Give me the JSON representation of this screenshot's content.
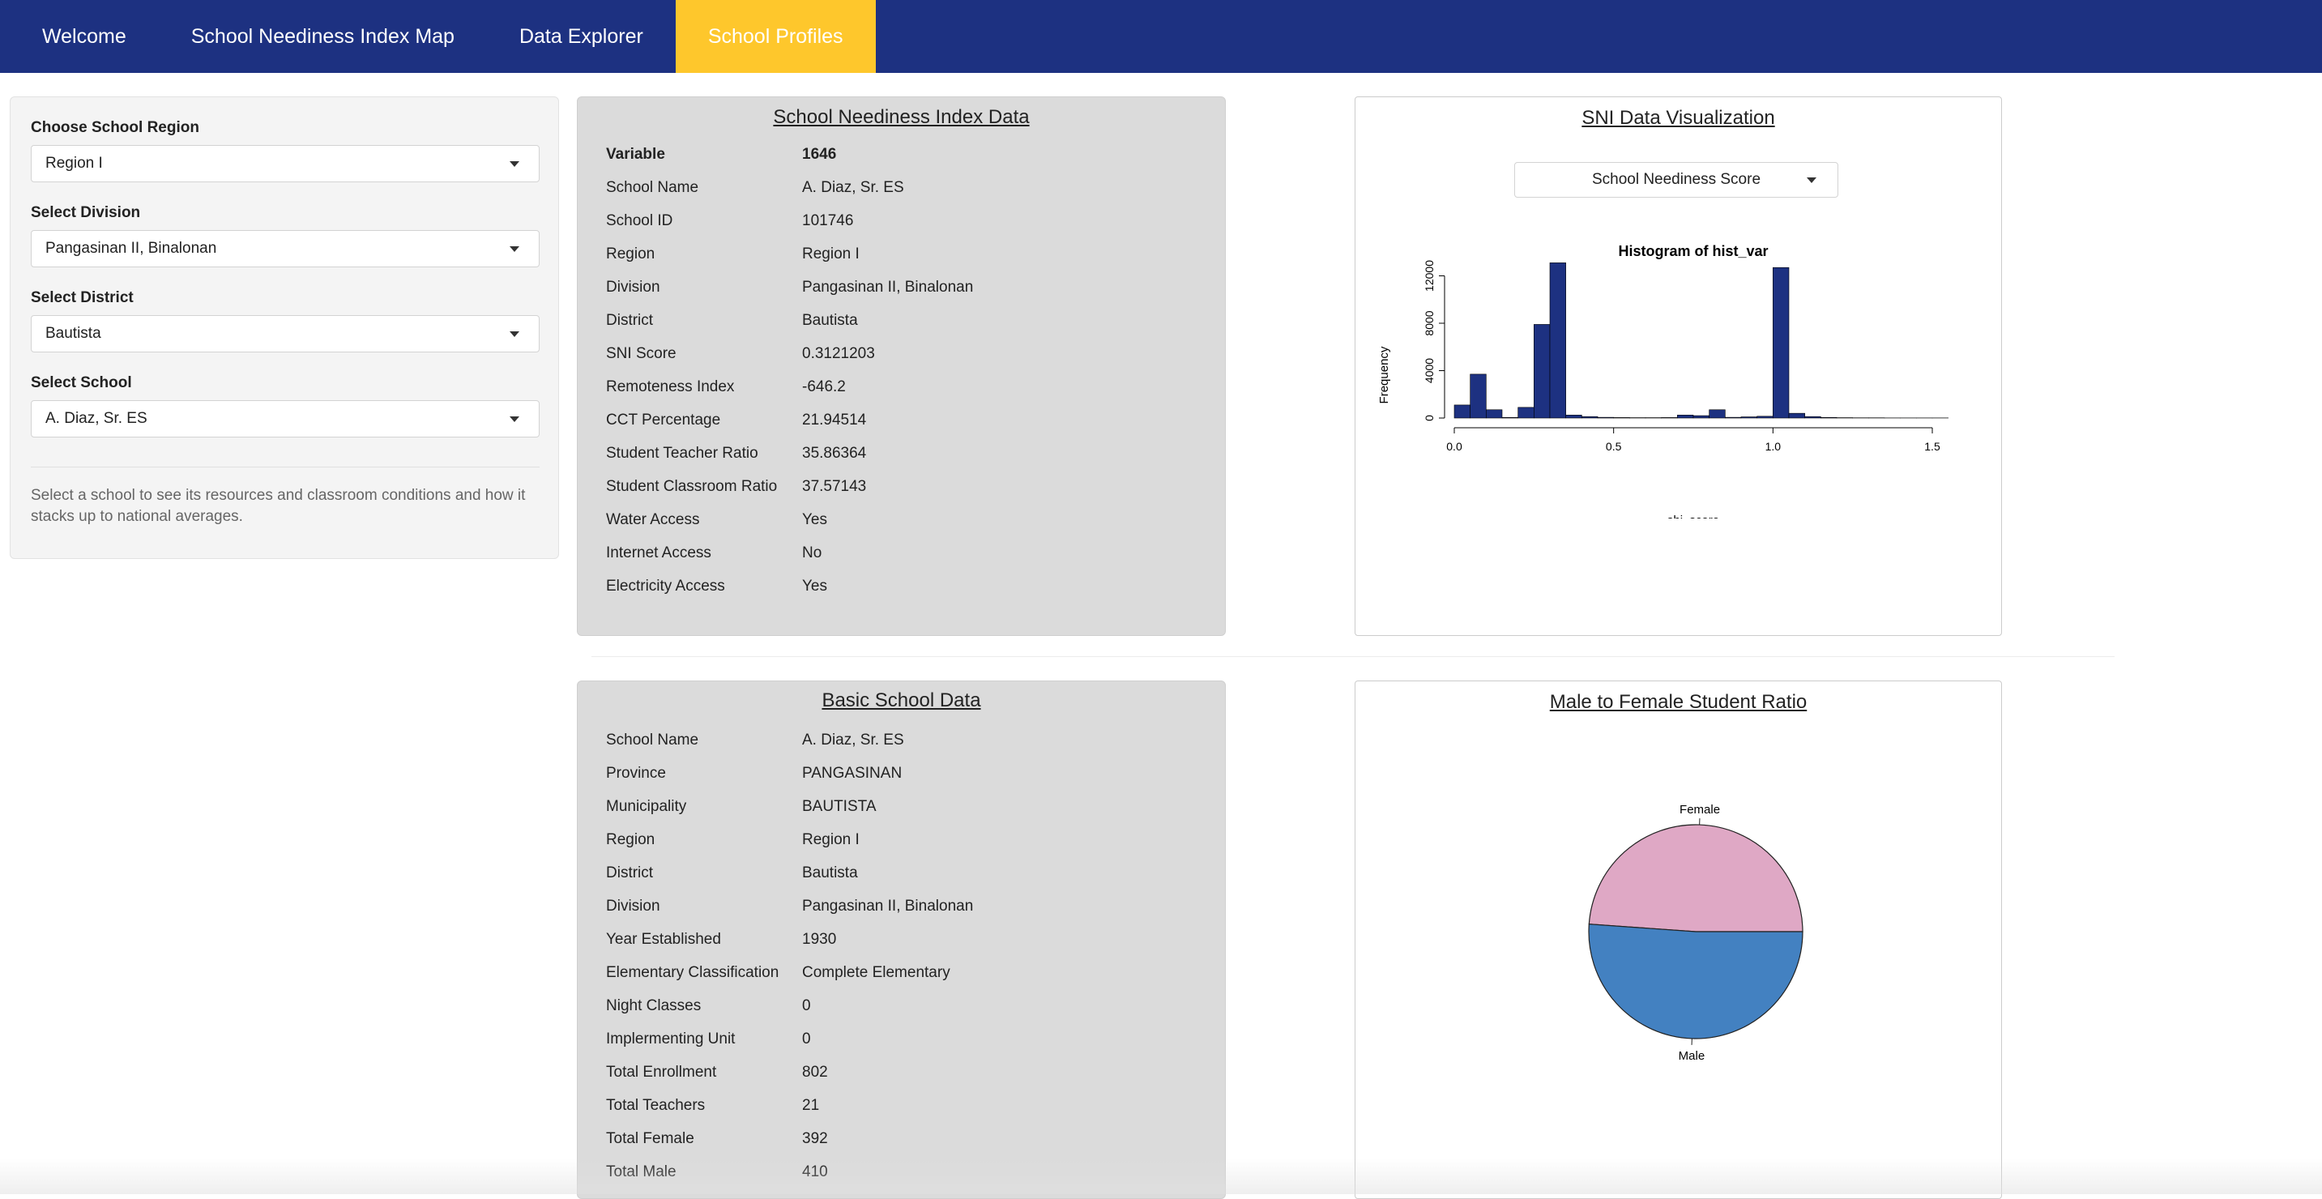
{
  "nav": {
    "items": [
      {
        "label": "Welcome",
        "active": false
      },
      {
        "label": "School Neediness Index Map",
        "active": false
      },
      {
        "label": "Data Explorer",
        "active": false
      },
      {
        "label": "School Profiles",
        "active": true
      }
    ]
  },
  "sidebar": {
    "region": {
      "label": "Choose School Region",
      "value": "Region I"
    },
    "division": {
      "label": "Select Division",
      "value": "Pangasinan II, Binalonan"
    },
    "district": {
      "label": "Select District",
      "value": "Bautista"
    },
    "school": {
      "label": "Select School",
      "value": "A. Diaz, Sr. ES"
    },
    "help_text": "Select a school to see its resources and classroom conditions and how it stacks up to national averages."
  },
  "sni_panel": {
    "title": "School Neediness Index Data",
    "header": {
      "key": "Variable",
      "value": "1646"
    },
    "rows": [
      {
        "key": "School Name",
        "value": "A. Diaz, Sr. ES"
      },
      {
        "key": "School ID",
        "value": "101746"
      },
      {
        "key": "Region",
        "value": "Region I"
      },
      {
        "key": "Division",
        "value": "Pangasinan II, Binalonan"
      },
      {
        "key": "District",
        "value": "Bautista"
      },
      {
        "key": "SNI Score",
        "value": "0.3121203"
      },
      {
        "key": "Remoteness Index",
        "value": "-646.2"
      },
      {
        "key": "CCT Percentage",
        "value": "21.94514"
      },
      {
        "key": "Student Teacher Ratio",
        "value": "35.86364"
      },
      {
        "key": "Student Classroom Ratio",
        "value": "37.57143"
      },
      {
        "key": "Water Access",
        "value": "Yes"
      },
      {
        "key": "Internet Access",
        "value": "No"
      },
      {
        "key": "Electricity Access",
        "value": "Yes"
      }
    ]
  },
  "basic_panel": {
    "title": "Basic School Data",
    "rows": [
      {
        "key": "School Name",
        "value": "A. Diaz, Sr. ES"
      },
      {
        "key": "Province",
        "value": "PANGASINAN"
      },
      {
        "key": "Municipality",
        "value": "BAUTISTA"
      },
      {
        "key": "Region",
        "value": "Region I"
      },
      {
        "key": "District",
        "value": "Bautista"
      },
      {
        "key": "Division",
        "value": "Pangasinan II, Binalonan"
      },
      {
        "key": "Year Established",
        "value": "1930"
      },
      {
        "key": "Elementary Classification",
        "value": "Complete Elementary"
      },
      {
        "key": "Night Classes",
        "value": "0"
      },
      {
        "key": "Implermenting Unit",
        "value": "0"
      },
      {
        "key": "Total Enrollment",
        "value": "802"
      },
      {
        "key": "Total Teachers",
        "value": "21"
      },
      {
        "key": "Total Female",
        "value": "392"
      },
      {
        "key": "Total Male",
        "value": "410"
      }
    ]
  },
  "sni_viz": {
    "title": "SNI Data Visualization",
    "select_value": "School Neediness Score"
  },
  "ratio_viz": {
    "title": "Male to Female Student Ratio"
  },
  "chart_data": [
    {
      "type": "bar",
      "title": "Histogram of hist_var",
      "xlabel": "shi_score",
      "ylabel": "Frequency",
      "bin_width": 0.05,
      "x": [
        0.0,
        0.05,
        0.1,
        0.15,
        0.2,
        0.25,
        0.3,
        0.35,
        0.4,
        0.45,
        0.5,
        0.55,
        0.6,
        0.65,
        0.7,
        0.75,
        0.8,
        0.85,
        0.9,
        0.95,
        1.0,
        1.05,
        1.1,
        1.15,
        1.2,
        1.25,
        1.3,
        1.35,
        1.4,
        1.45,
        1.5
      ],
      "values": [
        1100,
        3700,
        700,
        50,
        900,
        7900,
        13100,
        250,
        120,
        60,
        40,
        30,
        30,
        40,
        250,
        200,
        700,
        60,
        100,
        150,
        12700,
        400,
        120,
        50,
        30,
        20,
        20,
        10,
        10,
        10,
        10
      ],
      "xlim": [
        0.0,
        1.5
      ],
      "ylim": [
        0,
        13000
      ],
      "xticks": [
        "0.0",
        "0.5",
        "1.0",
        "1.5"
      ],
      "yticks": [
        "0",
        "4000",
        "8000",
        "12000"
      ],
      "color": "#1d3181"
    },
    {
      "type": "pie",
      "labels": [
        "Female",
        "Male"
      ],
      "values": [
        392,
        410
      ],
      "colors": [
        "#dfa8c5",
        "#4381c1"
      ]
    }
  ]
}
